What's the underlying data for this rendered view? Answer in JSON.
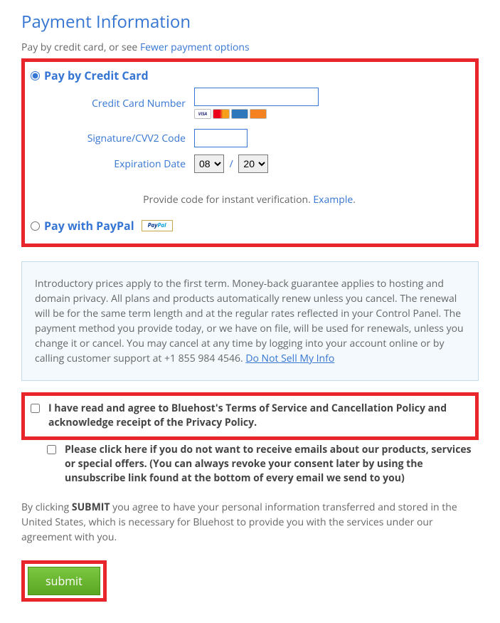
{
  "title": "Payment Information",
  "subline": {
    "prefix": "Pay by credit card, or see ",
    "link": "Fewer payment options"
  },
  "payCredit": {
    "label": "Pay by Credit Card",
    "ccLabel": "Credit Card Number",
    "cvvLabel": "Signature/CVV2 Code",
    "expLabel": "Expiration Date",
    "month": "08",
    "year": "20",
    "verifyPrefix": "Provide code for instant verification. ",
    "verifyLink": "Example",
    "verifySuffix": "."
  },
  "payPaypal": {
    "label": "Pay with PayPal"
  },
  "info": {
    "text": "Introductory prices apply to the first term. Money-back guarantee applies to hosting and domain privacy. All plans and products automatically renew unless you cancel. The renewal will be for the same term length and at the regular rates reflected in your Control Panel. The payment method you provide today, or we have on file, will be used for renewals, unless you change it or cancel. You may cancel at any time by logging into your account online or by calling customer support at +1 855 984 4546. ",
    "dnsLink": "Do Not Sell My Info"
  },
  "agree": {
    "p1": "I have read and agree to Bluehost's ",
    "tosLink": "Terms of Service",
    "p2": " and ",
    "cancelLink": "Cancellation Policy",
    "p3": " and acknowledge receipt of the ",
    "privacyLink": "Privacy Policy",
    "p4": "."
  },
  "emailOpt": "Please click here if you do not want to receive emails about our products, services or special offers. (You can always revoke your consent later by using the unsubscribe link found at the bottom of every email we send to you)",
  "footer": {
    "p1": "By clicking ",
    "bold": "SUBMIT",
    "p2": " you agree to have your personal information transferred and stored in the United States, which is necessary for Bluehost to provide you with the services under our agreement with you."
  },
  "submitLabel": "submit"
}
